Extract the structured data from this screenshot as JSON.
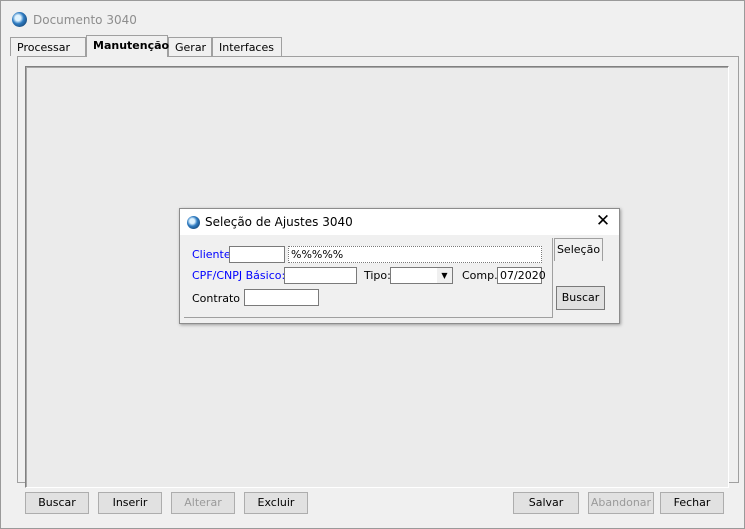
{
  "window": {
    "title": "Documento 3040",
    "icon": "app-globe-icon"
  },
  "tabs": [
    {
      "label": "Processar"
    },
    {
      "label": "Manutenção",
      "active": true
    },
    {
      "label": "Gerar"
    },
    {
      "label": "Interfaces"
    }
  ],
  "toolbar": {
    "buscar": "Buscar",
    "inserir": "Inserir",
    "alterar": "Alterar",
    "excluir": "Excluir",
    "salvar": "Salvar",
    "abandonar": "Abandonar",
    "fechar": "Fechar"
  },
  "dialog": {
    "title": "Seleção de Ajustes 3040",
    "close": "✕",
    "cliente_label": "Cliente:",
    "cliente_code": "",
    "cliente_name": "%%%%%",
    "cpf_label": "CPF/CNPJ Básico:",
    "cpf_value": "",
    "tipo_label": "Tipo:",
    "tipo_value": "",
    "comp_label": "Comp.:",
    "comp_value": "07/2020",
    "contrato_label": "Contrato",
    "contrato_value": "",
    "selecao_label": "Seleção",
    "buscar_label": "Buscar"
  }
}
